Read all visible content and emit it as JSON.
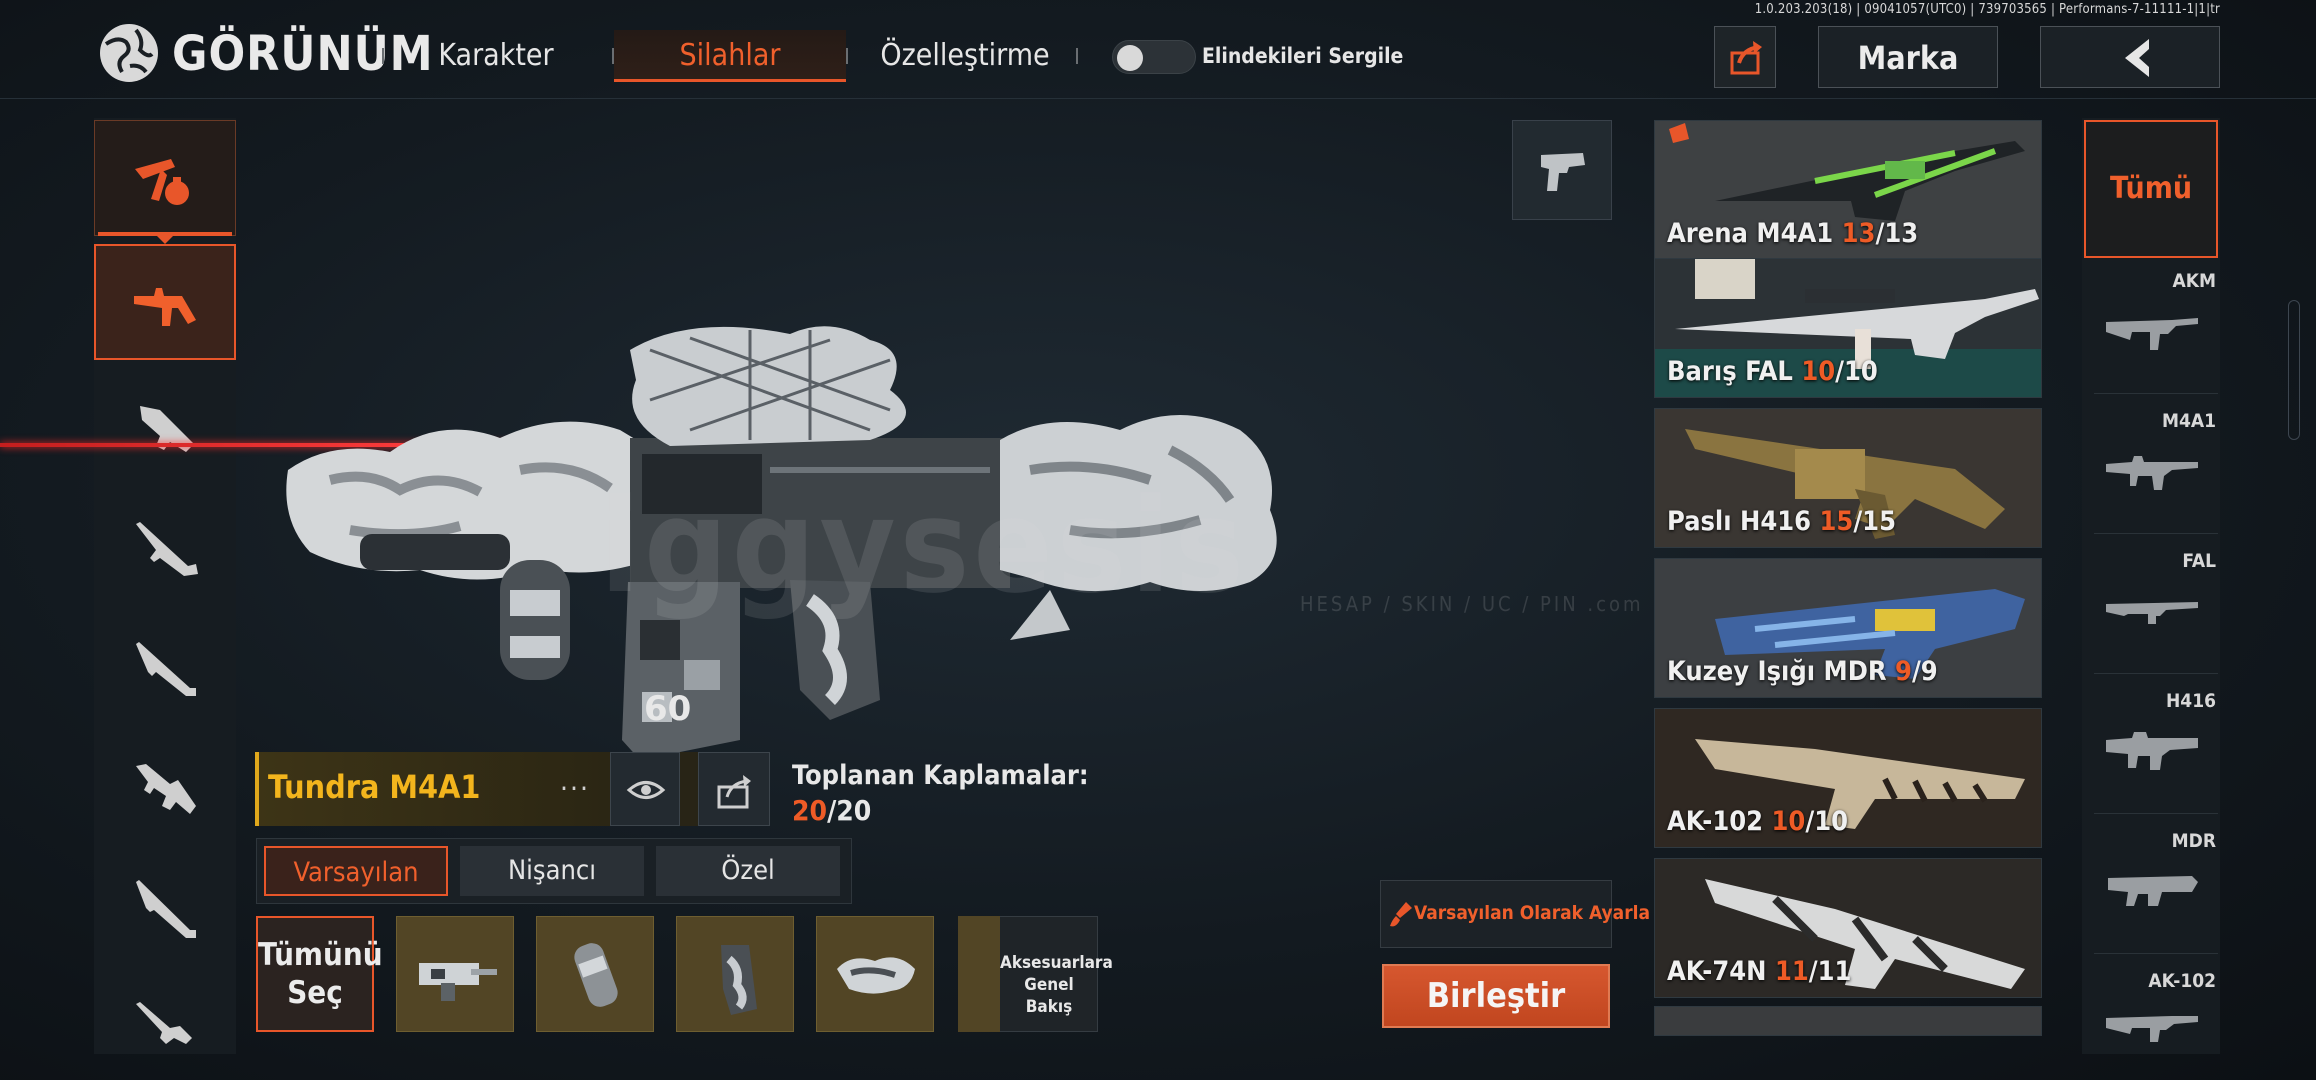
{
  "header": {
    "version": "1.0.203.203(18) | 09041057(UTC0) | 739703565 | Performans-7-11111-1|1|tr",
    "title": "GÖRÜNÜM",
    "tabs": [
      {
        "label": "Karakter",
        "active": false
      },
      {
        "label": "Silahlar",
        "active": true
      },
      {
        "label": "Özelleştirme",
        "active": false
      }
    ],
    "toggle_label": "Elindekileri Sergile",
    "toggle_on": false,
    "brand_label": "Marka"
  },
  "weapon": {
    "name": "Tundra M4A1",
    "collected_label": "Toplanan Kaplamalar:",
    "collected_current": "20",
    "collected_total": "/20",
    "tabs": [
      "Varsayılan",
      "Nişancı",
      "Özel"
    ],
    "active_tab": "Varsayılan",
    "select_all_line1": "Tümünü",
    "select_all_line2": "Seç",
    "attachments": [
      "grip-stock-icon",
      "foregrip-icon",
      "pistol-grip-icon",
      "magazine-icon"
    ],
    "overview_line1": "Aksesuarlara",
    "overview_line2": "Genel Bakış",
    "set_default_label": "Varsayılan Olarak Ayarla",
    "merge_label": "Birleştir"
  },
  "watermark": {
    "main": "iggysesis",
    "sub": "HESAP / SKIN / UC / PIN  .com"
  },
  "skins": [
    {
      "name": "Arena M4A1",
      "count": "13",
      "total": "/13"
    },
    {
      "name": "Barış FAL",
      "count": "10",
      "total": "/10"
    },
    {
      "name": "Paslı H416",
      "count": "15",
      "total": "/15"
    },
    {
      "name": "Kuzey Işığı MDR",
      "count": "9",
      "total": "/9"
    },
    {
      "name": "AK-102",
      "count": "10",
      "total": "/10"
    },
    {
      "name": "AK-74N",
      "count": "11",
      "total": "/11"
    }
  ],
  "filters": {
    "all_label": "Tümü",
    "items": [
      "AKM",
      "M4A1",
      "FAL",
      "H416",
      "MDR",
      "AK-102"
    ]
  },
  "colors": {
    "accent": "#e8562a",
    "gold": "#f3b51d",
    "background": "#131a20"
  }
}
